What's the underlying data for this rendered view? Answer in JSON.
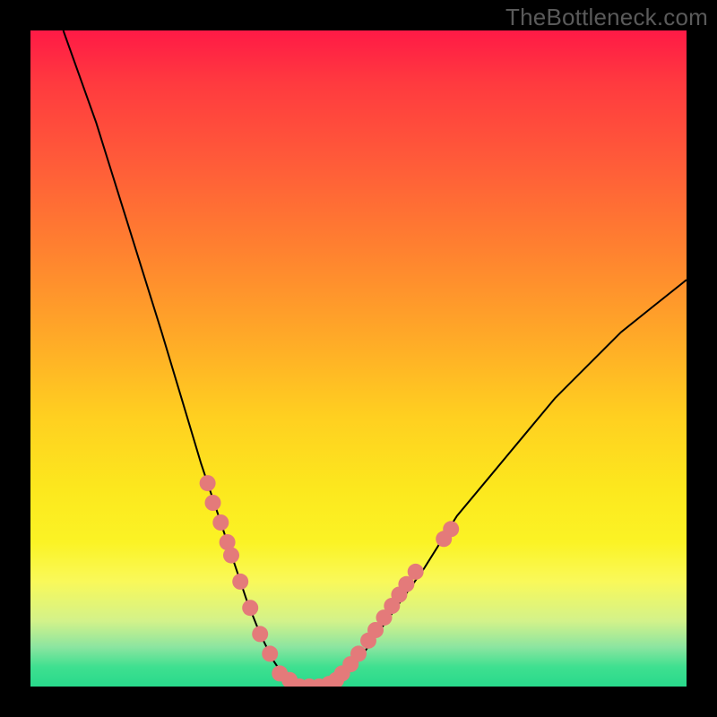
{
  "watermark": {
    "text": "TheBottleneck.com"
  },
  "gradient": {
    "top": "#ff1a46",
    "mid": "#ffd020",
    "bottom": "#29d98b"
  },
  "chart_data": {
    "type": "line",
    "title": "",
    "xlabel": "",
    "ylabel": "",
    "xlim": [
      0,
      100
    ],
    "ylim": [
      0,
      100
    ],
    "grid": false,
    "series": [
      {
        "name": "curve",
        "x": [
          5,
          10,
          15,
          20,
          23,
          26,
          29,
          31,
          33,
          35,
          37,
          39,
          41,
          43,
          45,
          47,
          50,
          55,
          60,
          65,
          70,
          75,
          80,
          85,
          90,
          95,
          100
        ],
        "values": [
          100,
          86,
          70,
          54,
          44,
          34,
          25,
          19,
          13,
          8,
          4,
          1,
          0,
          0,
          0,
          1,
          4,
          11,
          18,
          26,
          32,
          38,
          44,
          49,
          54,
          58,
          62
        ]
      }
    ],
    "markers": {
      "color": "#e47a7a",
      "radius_px": 9,
      "points_xy": [
        [
          27.0,
          31.0
        ],
        [
          27.8,
          28.0
        ],
        [
          29.0,
          25.0
        ],
        [
          30.0,
          22.0
        ],
        [
          30.6,
          20.0
        ],
        [
          32.0,
          16.0
        ],
        [
          33.5,
          12.0
        ],
        [
          35.0,
          8.0
        ],
        [
          36.5,
          5.0
        ],
        [
          38.0,
          2.0
        ],
        [
          39.5,
          1.0
        ],
        [
          41.0,
          0.0
        ],
        [
          42.5,
          0.0
        ],
        [
          44.0,
          0.0
        ],
        [
          45.5,
          0.4
        ],
        [
          46.6,
          1.0
        ],
        [
          47.5,
          2.0
        ],
        [
          48.8,
          3.4
        ],
        [
          50.0,
          5.0
        ],
        [
          51.5,
          7.0
        ],
        [
          52.6,
          8.6
        ],
        [
          53.9,
          10.5
        ],
        [
          55.1,
          12.3
        ],
        [
          56.2,
          14.0
        ],
        [
          57.3,
          15.6
        ],
        [
          58.7,
          17.5
        ],
        [
          63.0,
          22.5
        ],
        [
          64.1,
          24.0
        ]
      ]
    }
  }
}
